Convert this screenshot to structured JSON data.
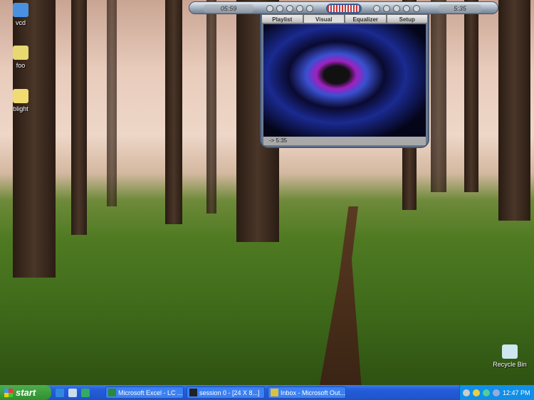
{
  "desktop": {
    "icons": [
      {
        "label": "vcd"
      },
      {
        "label": "foo"
      },
      {
        "label": "blight"
      },
      {
        "label": "Recycle Bin"
      }
    ]
  },
  "player": {
    "elapsed": "05:59",
    "total": "5:35",
    "tabs": [
      "Playlist",
      "Visual",
      "Equalizer",
      "Setup"
    ],
    "active_tab": "Visual",
    "status": "-> 5:35"
  },
  "taskbar": {
    "start": "start",
    "tasks": [
      "Microsoft Excel - LC ...",
      "session 0 - [24 X 8...]",
      "Inbox - Microsoft Out..."
    ],
    "clock": "12:47 PM"
  }
}
